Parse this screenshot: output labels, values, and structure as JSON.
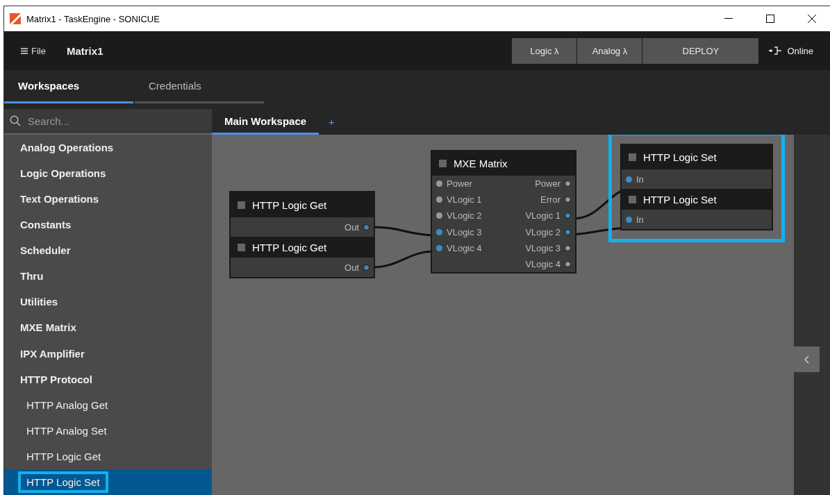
{
  "window": {
    "title": "Matrix1 - TaskEngine - SONICUE"
  },
  "header": {
    "menu": "File",
    "project": "Matrix1",
    "buttons": [
      "Logic λ",
      "Analog λ",
      "DEPLOY"
    ],
    "status": "Online"
  },
  "panel_tabs": [
    {
      "label": "Workspaces",
      "selected": true
    },
    {
      "label": "Credentials",
      "selected": false
    }
  ],
  "search": {
    "placeholder": "Search..."
  },
  "sidebar": {
    "items": [
      {
        "label": "Analog Operations",
        "selected": false
      },
      {
        "label": "Logic Operations",
        "selected": false
      },
      {
        "label": "Text Operations",
        "selected": false
      },
      {
        "label": "Constants",
        "selected": false
      },
      {
        "label": "Scheduler",
        "selected": false
      },
      {
        "label": "Thru",
        "selected": false
      },
      {
        "label": "Utilities",
        "selected": false
      },
      {
        "label": "MXE Matrix",
        "selected": false
      },
      {
        "label": "IPX Amplifier",
        "selected": false
      },
      {
        "label": "HTTP Protocol",
        "selected": false,
        "children": [
          {
            "label": "HTTP Analog Get",
            "selected": false,
            "highlighted": false
          },
          {
            "label": "HTTP Analog Set",
            "selected": false,
            "highlighted": false
          },
          {
            "label": "HTTP Logic Get",
            "selected": false,
            "highlighted": false
          },
          {
            "label": "HTTP Logic Set",
            "selected": true,
            "highlighted": true
          }
        ]
      }
    ]
  },
  "workspace_tabs": [
    {
      "label": "Main Workspace",
      "selected": true
    }
  ],
  "add_tab": "+",
  "canvas": {
    "groups": [
      {
        "highlighted": false,
        "nodes": [
          {
            "title": "HTTP Logic Get",
            "rows": [
              {
                "left": null,
                "right": {
                  "label": "Out",
                  "connected": true
                }
              }
            ]
          },
          {
            "title": "HTTP Logic Get",
            "rows": [
              {
                "left": null,
                "right": {
                  "label": "Out",
                  "connected": true
                }
              }
            ]
          }
        ]
      },
      {
        "highlighted": false,
        "nodes": [
          {
            "title": "MXE Matrix",
            "rows": [
              {
                "left": {
                  "label": "Power",
                  "connected": false
                },
                "right": {
                  "label": "Power",
                  "connected": false
                }
              },
              {
                "left": {
                  "label": "VLogic 1",
                  "connected": false
                },
                "right": {
                  "label": "Error",
                  "connected": false
                }
              },
              {
                "left": {
                  "label": "VLogic 2",
                  "connected": false
                },
                "right": {
                  "label": "VLogic 1",
                  "connected": true
                }
              },
              {
                "left": {
                  "label": "VLogic 3",
                  "connected": true
                },
                "right": {
                  "label": "VLogic 2",
                  "connected": true
                }
              },
              {
                "left": {
                  "label": "VLogic 4",
                  "connected": true
                },
                "right": {
                  "label": "VLogic 3",
                  "connected": false
                }
              },
              {
                "left": null,
                "right": {
                  "label": "VLogic 4",
                  "connected": false
                }
              }
            ]
          }
        ]
      },
      {
        "highlighted": true,
        "nodes": [
          {
            "title": "HTTP Logic Set",
            "rows": [
              {
                "left": {
                  "label": "In",
                  "connected": true
                },
                "right": null
              }
            ]
          },
          {
            "title": "HTTP Logic Set",
            "rows": [
              {
                "left": {
                  "label": "In",
                  "connected": true
                },
                "right": null
              }
            ]
          }
        ]
      }
    ]
  }
}
